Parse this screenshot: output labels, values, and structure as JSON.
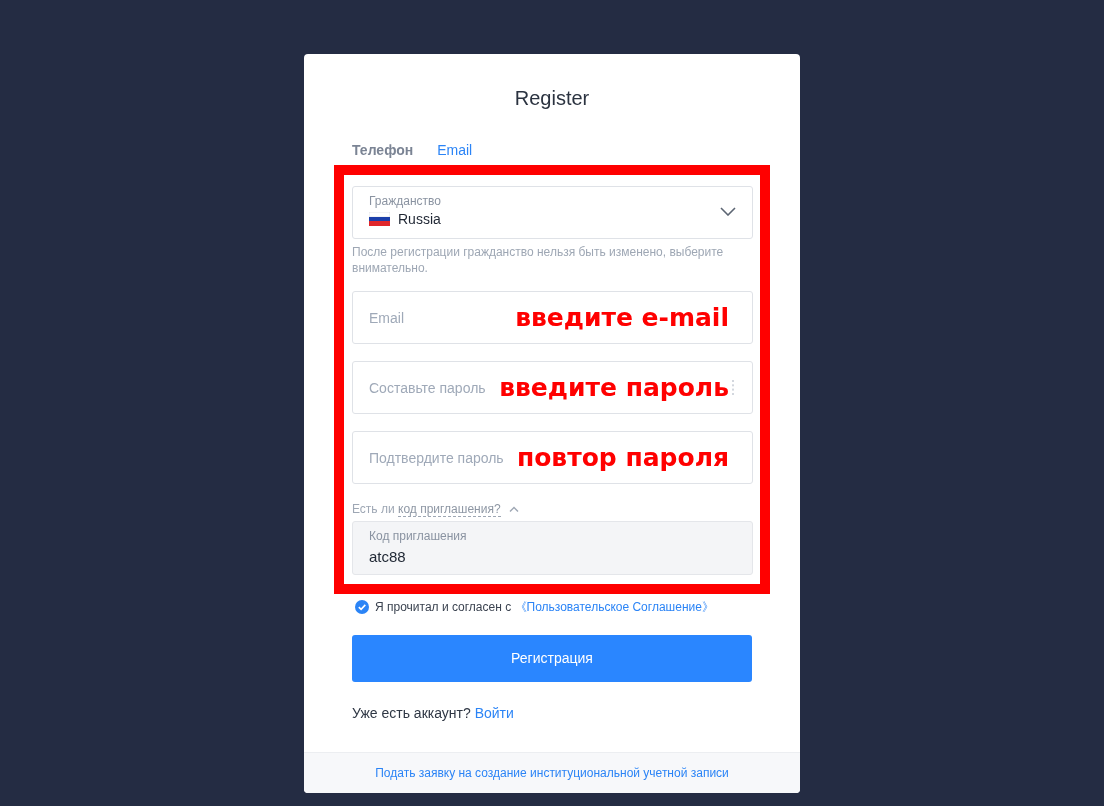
{
  "dialog": {
    "title": "Register"
  },
  "tabs": [
    {
      "label": "Телефон",
      "selected": false
    },
    {
      "label": "Email",
      "selected": true
    }
  ],
  "citizenship": {
    "label": "Гражданство",
    "value": "Russia",
    "hint": "После регистрации гражданство нельзя быть изменено, выберите внимательно."
  },
  "fields": [
    {
      "kind": "email",
      "placeholder": "Email",
      "annotation": "введите e-mail"
    },
    {
      "kind": "password",
      "placeholder": "Составьте пароль",
      "annotation": "введите пароль"
    },
    {
      "kind": "confirm",
      "placeholder": "Подтвердите пароль",
      "annotation": "повтор пароля"
    }
  ],
  "invite": {
    "question": "Есть ли ",
    "link": "код приглашения?",
    "expanded": true,
    "label": "Код приглашения",
    "value": "atc88"
  },
  "agreement": {
    "checked": true,
    "text": "Я прочитал и согласен с ",
    "link": "《Пользовательское Соглашение》"
  },
  "submit": {
    "label": "Регистрация"
  },
  "login": {
    "text": "Уже есть аккаунт? ",
    "link": "Войти"
  },
  "footer": {
    "link": "Подать заявку на создание институциональной учетной записи"
  }
}
